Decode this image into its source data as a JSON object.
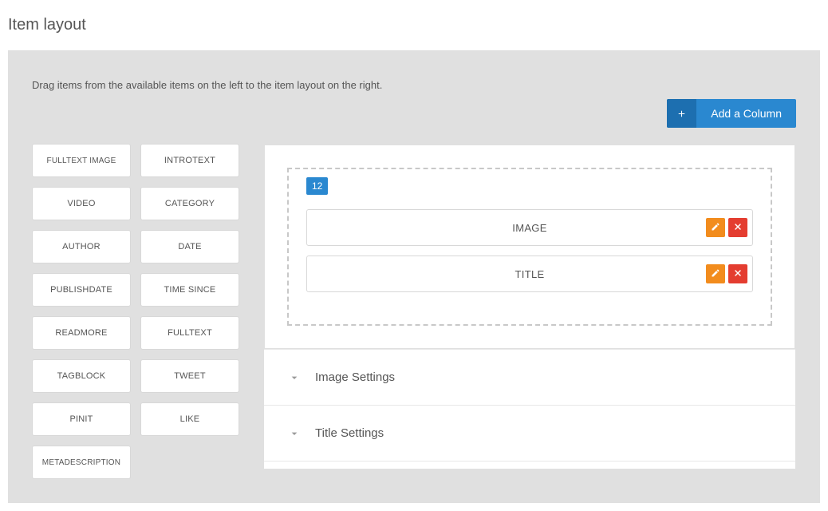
{
  "page_title": "Item layout",
  "instructions": "Drag items from the available items on the left to the item layout on the right.",
  "add_column_label": "Add a Column",
  "available_items": [
    "FULLTEXT IMAGE",
    "INTROTEXT",
    "VIDEO",
    "CATEGORY",
    "AUTHOR",
    "DATE",
    "PUBLISHDATE",
    "TIME SINCE",
    "READMORE",
    "FULLTEXT",
    "TAGBLOCK",
    "TWEET",
    "PINIT",
    "LIKE",
    "METADESCRIPTION"
  ],
  "layout": {
    "column_width": "12",
    "items": [
      {
        "label": "IMAGE"
      },
      {
        "label": "TITLE"
      }
    ]
  },
  "settings": [
    {
      "title": "Image Settings"
    },
    {
      "title": "Title Settings"
    }
  ]
}
